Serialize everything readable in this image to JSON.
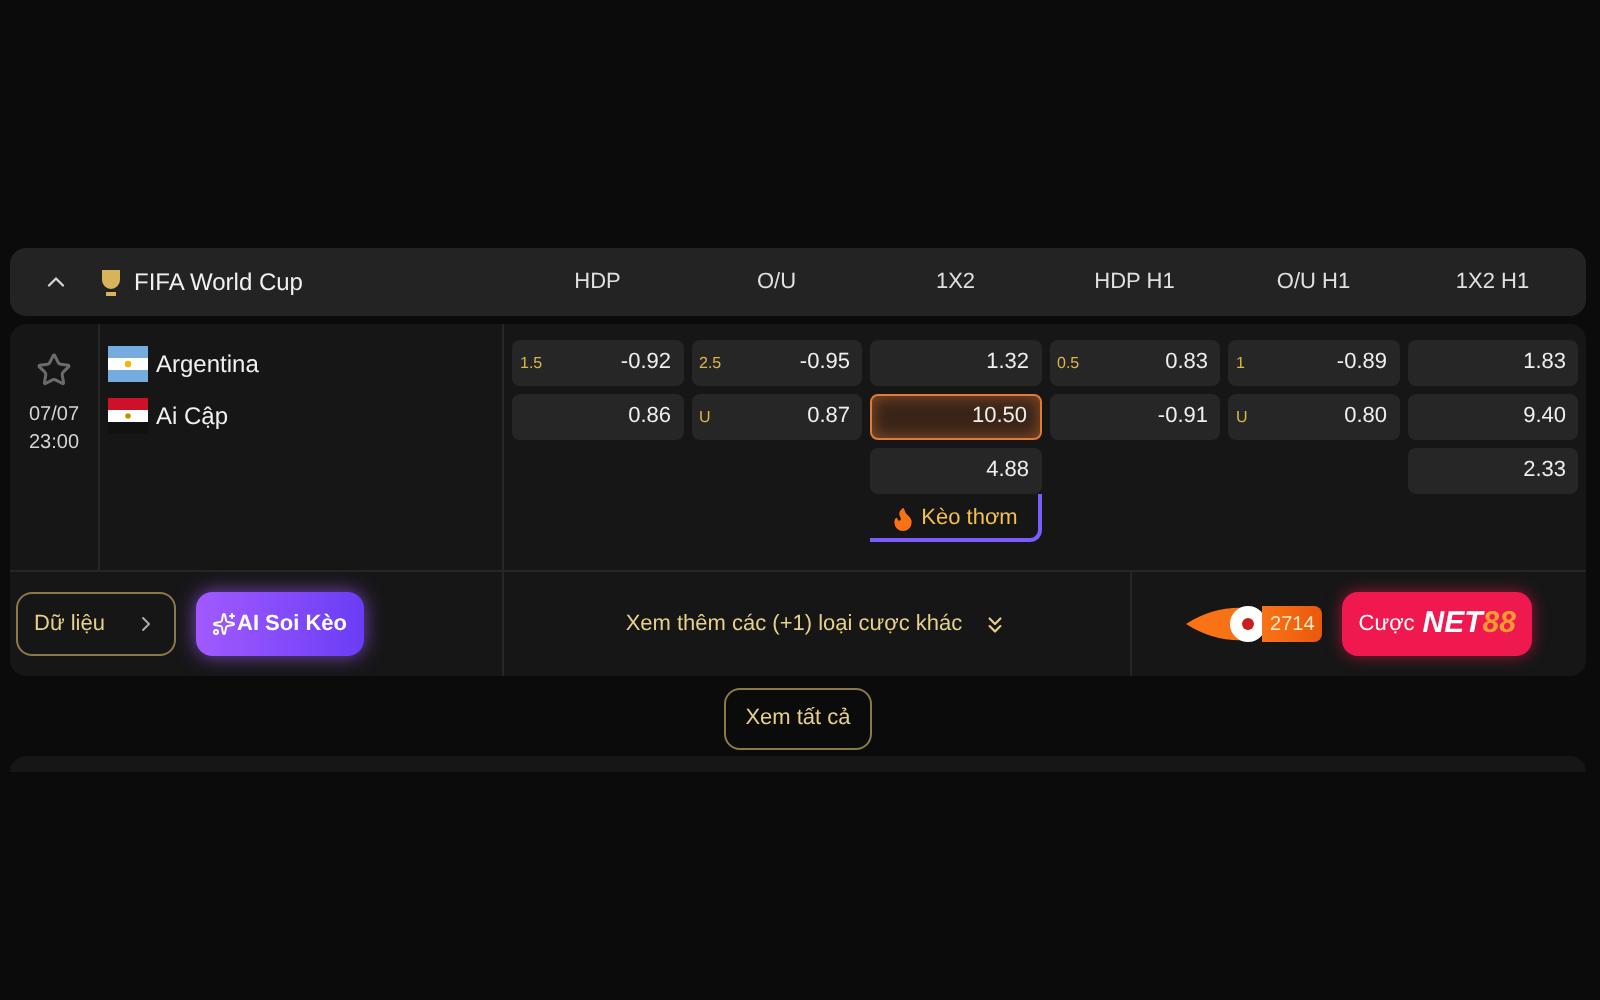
{
  "league": {
    "title": "FIFA World Cup",
    "expanded": true
  },
  "columns": [
    {
      "header": "HDP",
      "cells": [
        {
          "label": "1.5",
          "value": "-0.92",
          "selected": false
        },
        {
          "value": "0.86",
          "selected": false
        }
      ]
    },
    {
      "header": "O/U",
      "cells": [
        {
          "label": "2.5",
          "value": "-0.95",
          "selected": false
        },
        {
          "label": "U",
          "value": "0.87",
          "selected": false
        }
      ]
    },
    {
      "header": "1X2",
      "cells": [
        {
          "value": "1.32",
          "selected": false
        },
        {
          "value": "10.50",
          "selected": true
        },
        {
          "value": "4.88",
          "selected": false
        }
      ],
      "badge": "Kèo thơm"
    },
    {
      "header": "HDP H1",
      "cells": [
        {
          "label": "0.5",
          "value": "0.83",
          "selected": false
        },
        {
          "value": "-0.91",
          "selected": false
        }
      ]
    },
    {
      "header": "O/U H1",
      "cells": [
        {
          "label": "1",
          "value": "-0.89",
          "selected": false
        },
        {
          "label": "U",
          "value": "0.80",
          "selected": false
        }
      ]
    },
    {
      "header": "1X2 H1",
      "cells": [
        {
          "value": "1.83",
          "selected": false
        },
        {
          "value": "9.40",
          "selected": false
        },
        {
          "value": "2.33",
          "selected": false
        }
      ]
    }
  ],
  "match": {
    "date": "07/07",
    "time": "23:00",
    "favorite": false,
    "teams": [
      {
        "name": "Argentina",
        "kind": "argentina"
      },
      {
        "name": "Ai Cập",
        "kind": "egypt"
      }
    ]
  },
  "actions": {
    "data_button": "Dữ liệu",
    "ai_button": "AI Soi Kèo",
    "more_bets": "Xem thêm các (+1) loại cược khác",
    "fire_count": "2714",
    "bet_label": "Cược",
    "brand_main": "NET",
    "brand_num": "88"
  },
  "view_all": "Xem tất cả"
}
